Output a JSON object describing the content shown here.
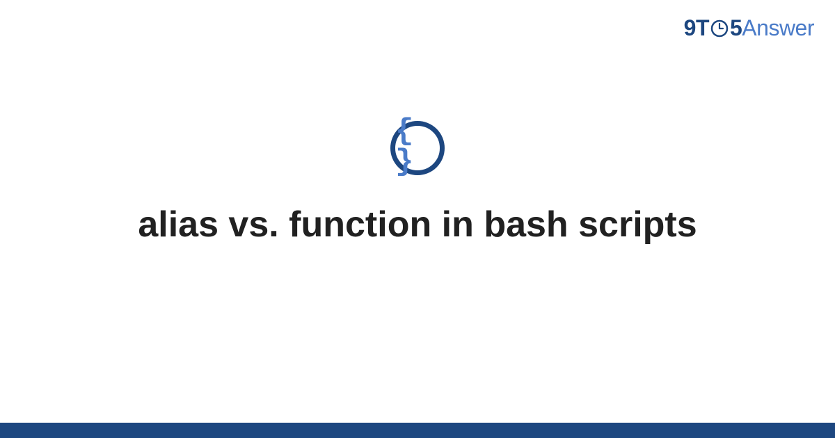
{
  "brand": {
    "part_nine": "9",
    "part_t": "T",
    "part_five": "5",
    "part_answer": "Answer"
  },
  "icon": {
    "name": "code-braces-icon",
    "glyph": "{ }"
  },
  "title": "alias vs. function in bash scripts",
  "colors": {
    "primary_dark": "#1d4780",
    "primary_light": "#4a7bc8",
    "text": "#212121",
    "background": "#ffffff"
  }
}
